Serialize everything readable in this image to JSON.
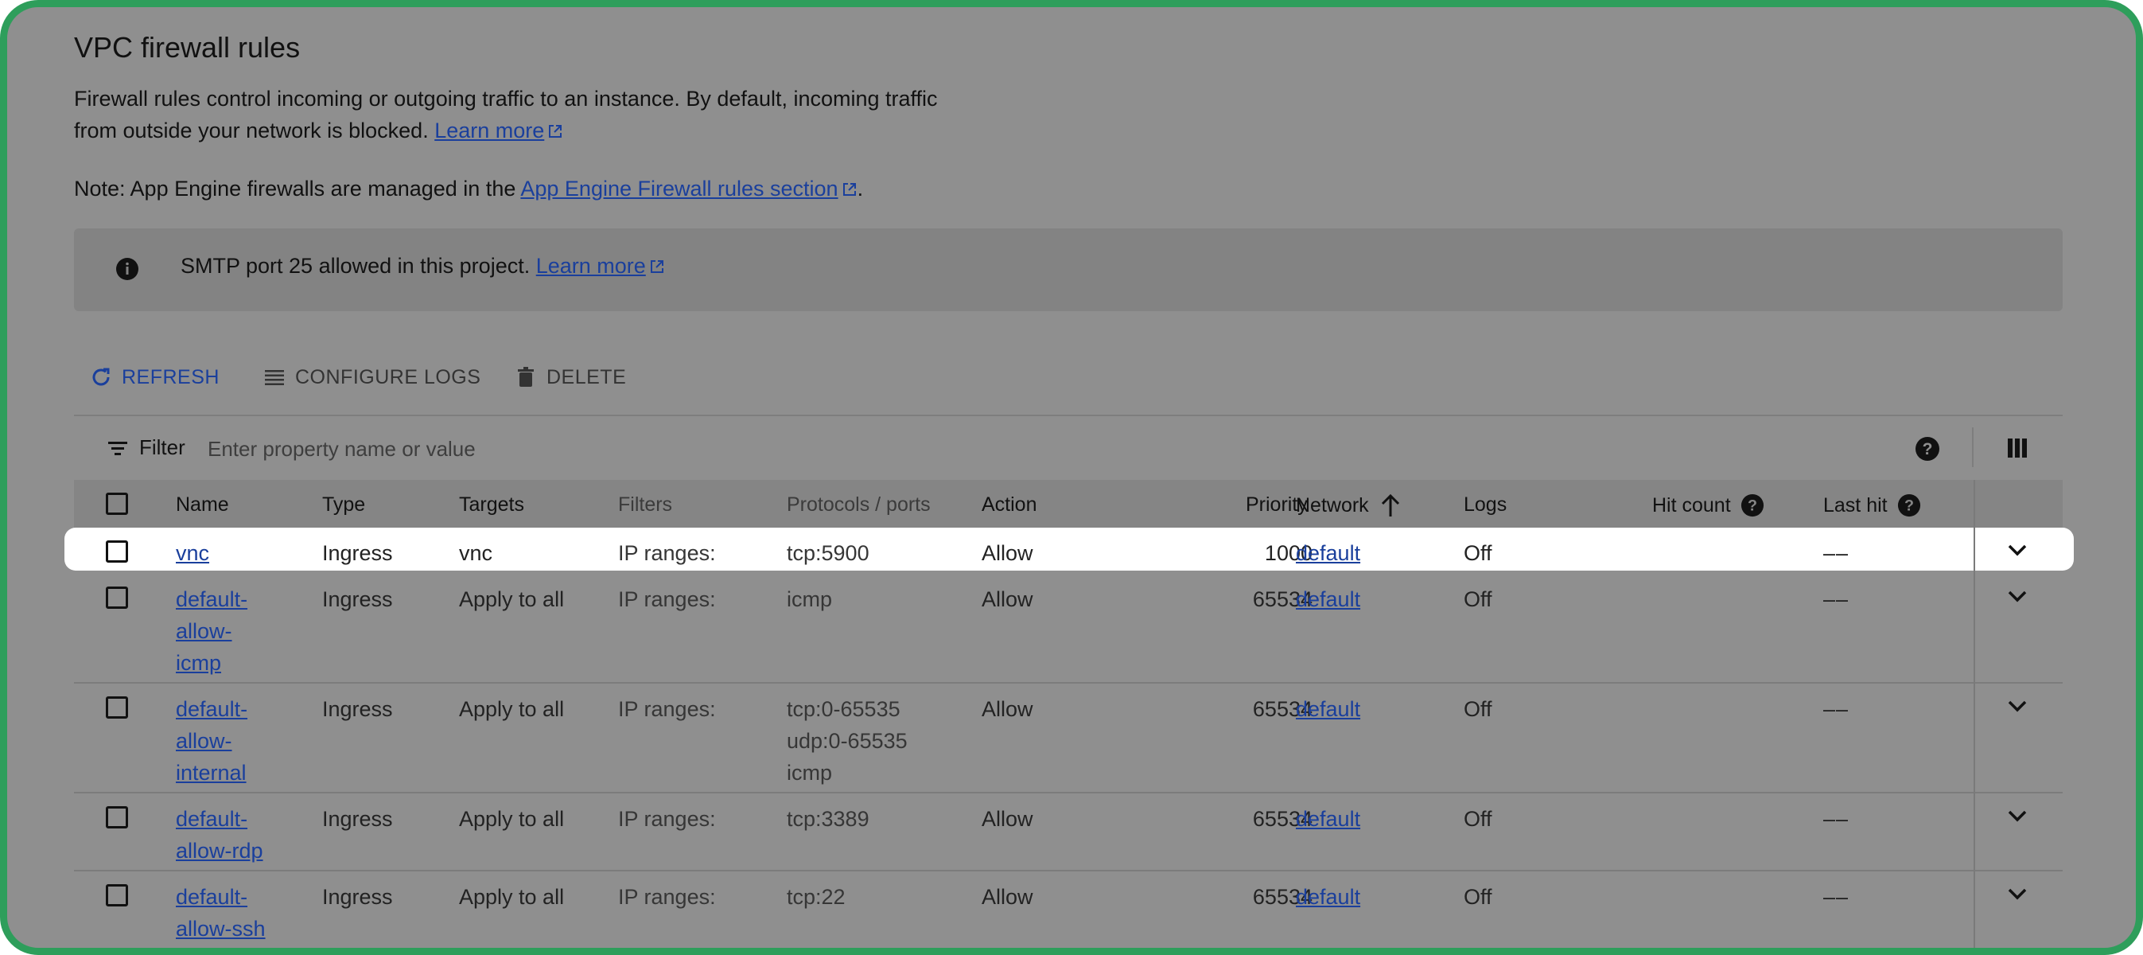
{
  "page": {
    "title": "VPC firewall rules",
    "description": "Firewall rules control incoming or outgoing traffic to an instance. By default, incoming traffic from outside your network is blocked.",
    "description_link": "Learn more",
    "note_prefix": "Note: App Engine firewalls are managed in the",
    "note_link": "App Engine Firewall rules section",
    "note_suffix": "."
  },
  "banner": {
    "text": "SMTP port 25 allowed in this project.",
    "link": "Learn more"
  },
  "toolbar": {
    "refresh": "REFRESH",
    "configure_logs": "CONFIGURE LOGS",
    "delete": "DELETE"
  },
  "filter": {
    "label": "Filter",
    "placeholder": "Enter property name or value"
  },
  "table": {
    "headers": {
      "name": "Name",
      "type": "Type",
      "targets": "Targets",
      "filters": "Filters",
      "protocols": "Protocols / ports",
      "action": "Action",
      "priority": "Priority",
      "network": "Network",
      "logs": "Logs",
      "hit_count": "Hit count",
      "last_hit": "Last hit"
    },
    "rows": [
      {
        "name": [
          "vnc"
        ],
        "type": "Ingress",
        "targets": "vnc",
        "filters": "IP ranges:",
        "protocols": [
          "tcp:5900"
        ],
        "action": "Allow",
        "priority": "1000",
        "network": "default",
        "logs": "Off",
        "hit_count": "–",
        "last_hit": "–",
        "highlighted": true
      },
      {
        "name": [
          "default-",
          "allow-",
          "icmp"
        ],
        "type": "Ingress",
        "targets": "Apply to all",
        "filters": "IP ranges:",
        "protocols": [
          "icmp"
        ],
        "action": "Allow",
        "priority": "65534",
        "network": "default",
        "logs": "Off",
        "hit_count": "–",
        "last_hit": "–"
      },
      {
        "name": [
          "default-",
          "allow-",
          "internal"
        ],
        "type": "Ingress",
        "targets": "Apply to all",
        "filters": "IP ranges:",
        "protocols": [
          "tcp:0-65535",
          "udp:0-65535",
          "icmp"
        ],
        "action": "Allow",
        "priority": "65534",
        "network": "default",
        "logs": "Off",
        "hit_count": "–",
        "last_hit": "–"
      },
      {
        "name": [
          "default-",
          "allow-rdp"
        ],
        "type": "Ingress",
        "targets": "Apply to all",
        "filters": "IP ranges:",
        "protocols": [
          "tcp:3389"
        ],
        "action": "Allow",
        "priority": "65534",
        "network": "default",
        "logs": "Off",
        "hit_count": "–",
        "last_hit": "–"
      },
      {
        "name": [
          "default-",
          "allow-ssh"
        ],
        "type": "Ingress",
        "targets": "Apply to all",
        "filters": "IP ranges:",
        "protocols": [
          "tcp:22"
        ],
        "action": "Allow",
        "priority": "65534",
        "network": "default",
        "logs": "Off",
        "hit_count": "–",
        "last_hit": "–"
      }
    ]
  },
  "colors": {
    "frame_border": "#2e9e5b",
    "overlay": "#8f8f8f",
    "link": "#1a3f9c",
    "refresh": "#1a3f9c"
  },
  "icons": {
    "info": "info-icon",
    "refresh": "refresh-icon",
    "configure_logs": "list-icon",
    "delete": "trash-icon",
    "filter": "filter-icon",
    "help": "help-icon",
    "columns": "column-display-icon",
    "sort": "arrow-up-icon",
    "expand": "chevron-down-icon",
    "external": "external-link-icon"
  }
}
